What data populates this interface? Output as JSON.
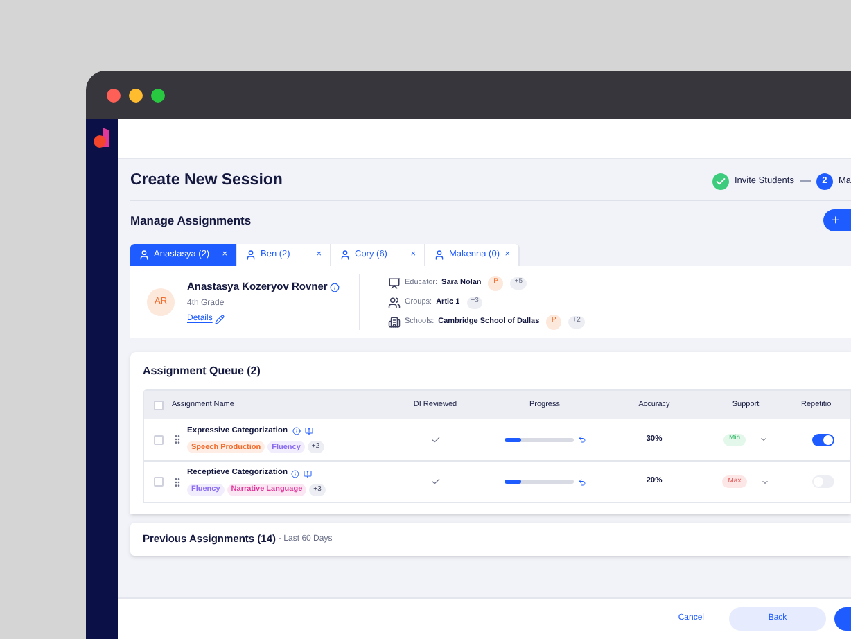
{
  "page": {
    "title": "Create New Session"
  },
  "steps": [
    {
      "label": "Invite Students",
      "done": true
    },
    {
      "label": "Ma",
      "number": "2",
      "done": false
    }
  ],
  "section": {
    "title": "Manage Assignments",
    "add_button": "+"
  },
  "student_tabs": [
    {
      "label": "Anastasya (2)",
      "selected": true,
      "close": "×"
    },
    {
      "label": "Ben (2)",
      "selected": false,
      "close": "×"
    },
    {
      "label": "Cory (6)",
      "selected": false,
      "close": "×"
    },
    {
      "label": "Makenna (0)",
      "selected": false,
      "close": "×"
    }
  ],
  "student": {
    "initials": "AR",
    "name": "Anastasya Kozeryov Rovner",
    "grade": "4th Grade",
    "details_link": "Details",
    "info": [
      {
        "kind": "educator",
        "label": "Educator:",
        "value": "Sara Nolan",
        "badge": "P",
        "more": "+5"
      },
      {
        "kind": "groups",
        "label": "Groups:",
        "value": "Artic 1",
        "more": "+3"
      },
      {
        "kind": "schools",
        "label": "Schools:",
        "value": "Cambridge School of Dallas",
        "badge": "P",
        "more": "+2"
      }
    ]
  },
  "queue": {
    "title": "Assignment Queue (2)",
    "columns": [
      "Assignment Name",
      "DI Reviewed",
      "Progress",
      "Accuracy",
      "Support",
      "Repetitio"
    ],
    "select_all_checked": false,
    "rows": [
      {
        "checked": false,
        "name": "Expressive Categorization",
        "tags": [
          {
            "label": "Speech Production",
            "color": "#f26b2b"
          },
          {
            "label": "Fluency",
            "color": "#8b6cf0"
          }
        ],
        "more_tags": "+2",
        "di_reviewed": true,
        "level": 0.25,
        "accuracy": "30%",
        "support": {
          "label": "Min",
          "kind": "min"
        },
        "on": true
      },
      {
        "checked": false,
        "name": "Receptieve Categorization",
        "tags": [
          {
            "label": "Fluency",
            "color": "#8b6cf0"
          },
          {
            "label": "Narrative Language",
            "color": "#e0379a"
          }
        ],
        "more_tags": "+3",
        "di_reviewed": true,
        "level": 0.25,
        "accuracy": "20%",
        "support": {
          "label": "Max",
          "kind": "max"
        },
        "on": false
      }
    ]
  },
  "previous": {
    "title": "Previous Assignments (14)",
    "subtitle": "- Last 60 Days"
  },
  "footer": {
    "cancel": "Cancel",
    "back": "Back"
  }
}
